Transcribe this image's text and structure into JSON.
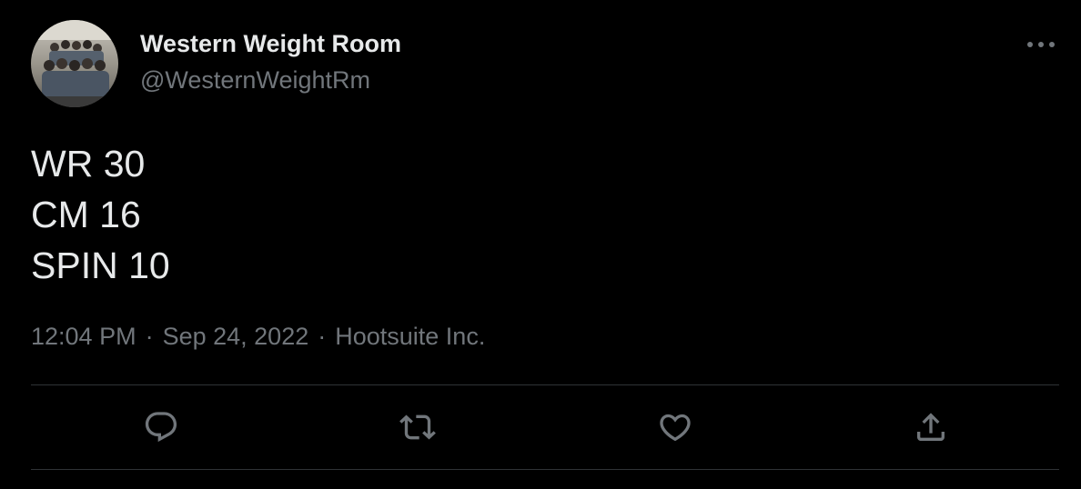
{
  "author": {
    "display_name": "Western Weight Room",
    "handle": "@WesternWeightRm",
    "avatar_icon": "group-photo-avatar"
  },
  "tweet": {
    "lines": [
      "WR 30",
      "CM 16",
      "SPIN 10"
    ],
    "time": "12:04 PM",
    "date": "Sep 24, 2022",
    "source": "Hootsuite Inc.",
    "separator": "·"
  },
  "actions": {
    "reply_icon": "reply-icon",
    "retweet_icon": "retweet-icon",
    "like_icon": "heart-icon",
    "share_icon": "share-icon",
    "more_icon": "more-options-icon"
  },
  "colors": {
    "background": "#000000",
    "primary_text": "#e7e9ea",
    "secondary_text": "#71767b",
    "divider": "#2f3336"
  }
}
